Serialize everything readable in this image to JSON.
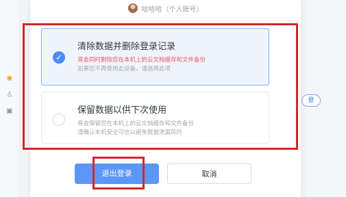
{
  "account": {
    "display": "哈哈哈（个人账号）",
    "avatar_icon": "avatar"
  },
  "options": [
    {
      "title": "清除数据并删除登录记录",
      "line1": "将会同时删除您在本机上的云文档缓存和文件备份",
      "line2": "如果您不再使用此设备，请选择此项",
      "selected": true
    },
    {
      "title": "保留数据以供下次使用",
      "line1": "将会保留您在本机上的云文档缓存和文件备份",
      "line2": "请确认本机安全可信以避免数据泄漏风险",
      "selected": false
    }
  ],
  "buttons": {
    "logout": "退出登录",
    "cancel": "取消"
  },
  "background": {
    "pill_label": "登"
  },
  "colors": {
    "accent": "#4b8bf5",
    "highlight": "#d3262b",
    "warning": "#f15a5a"
  }
}
